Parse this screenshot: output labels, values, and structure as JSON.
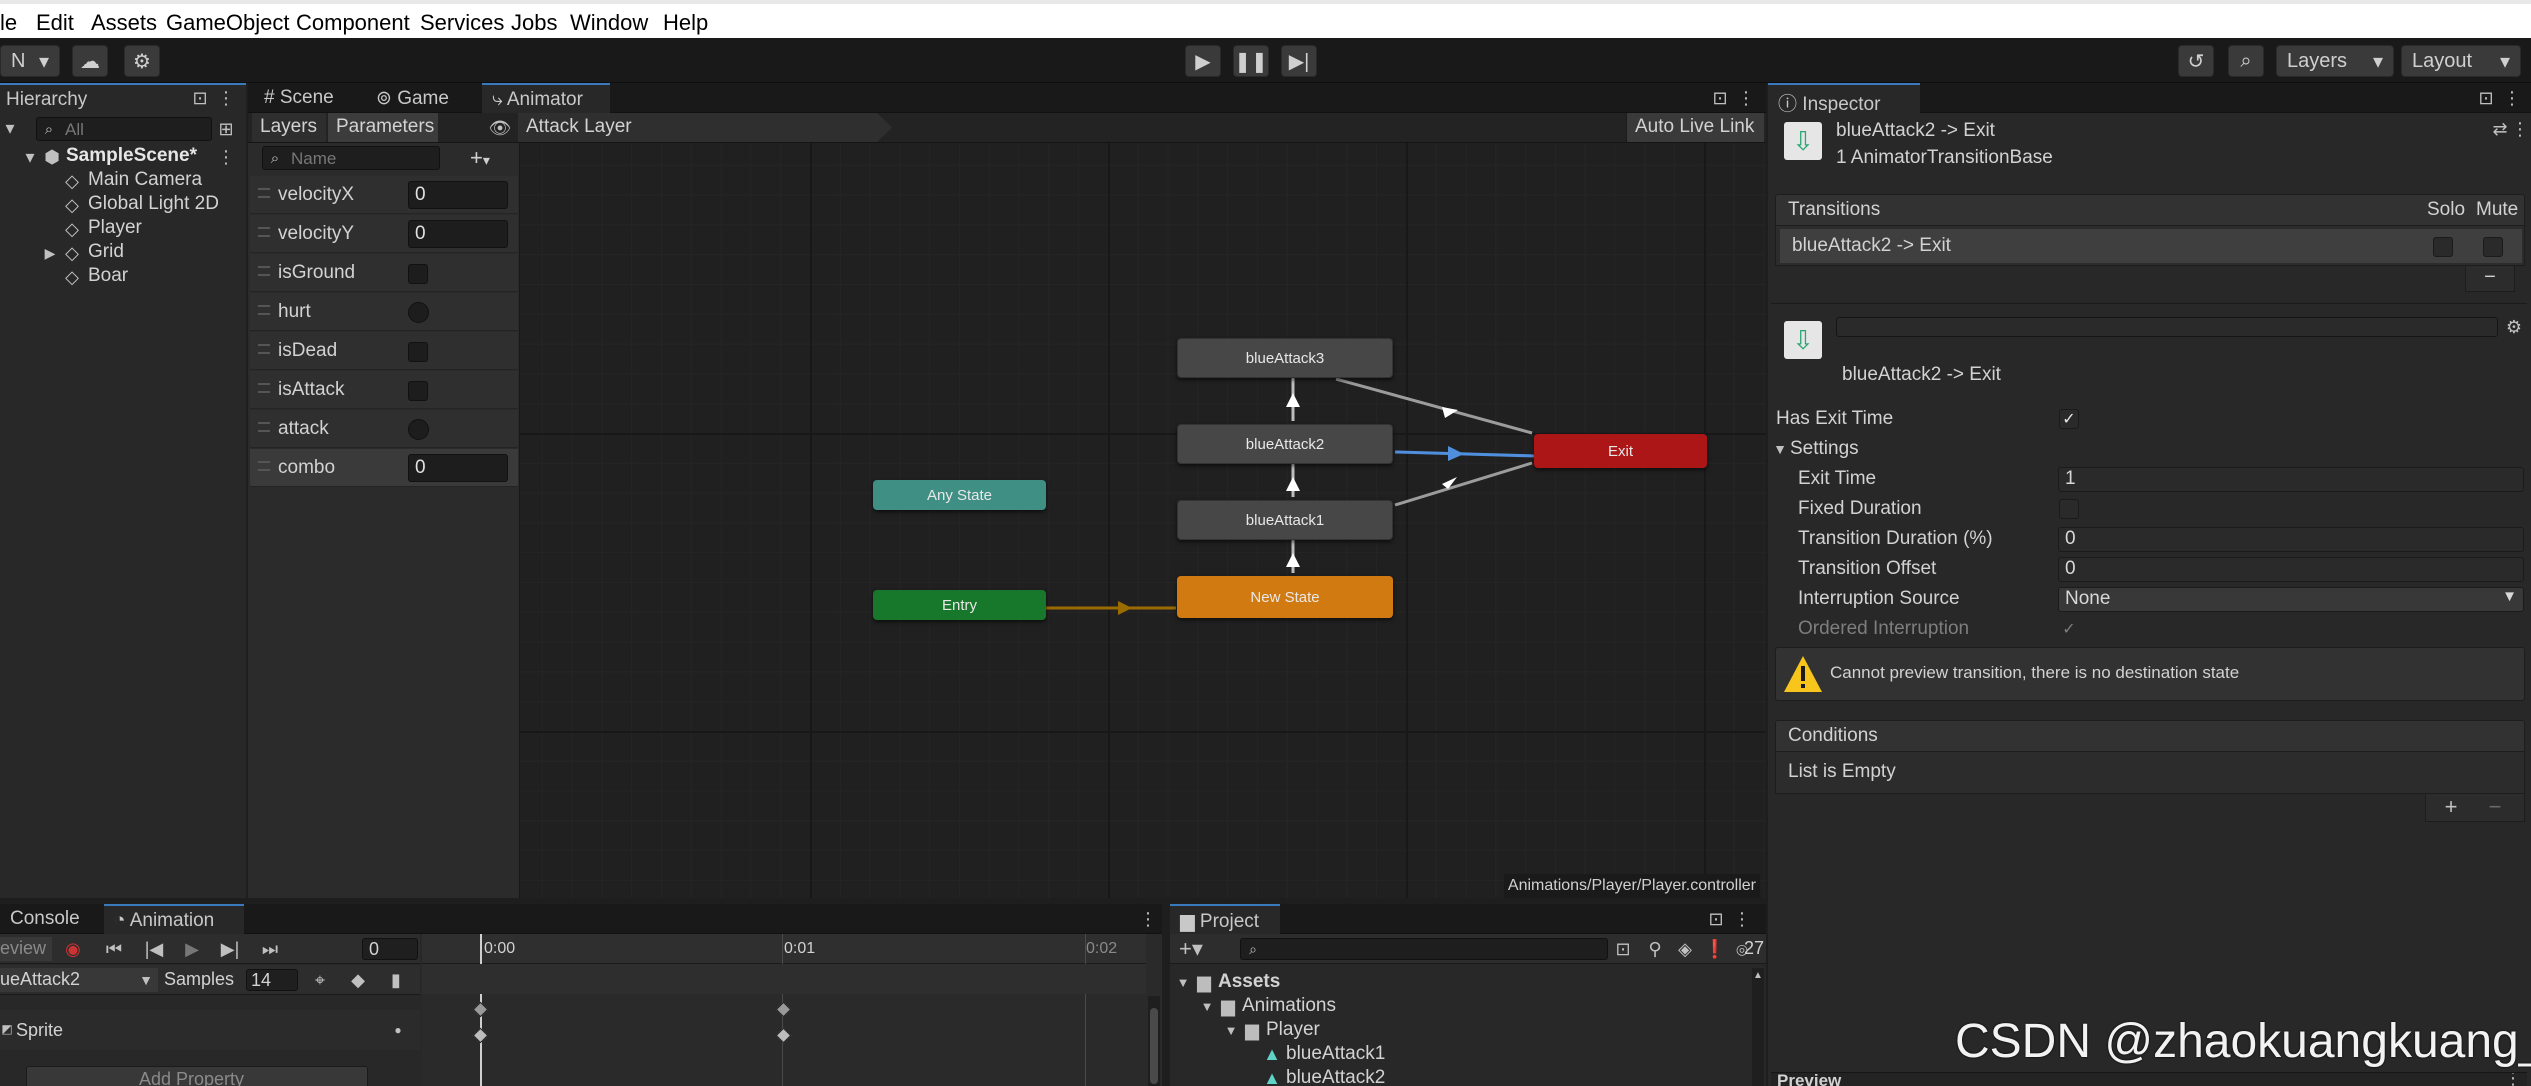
{
  "menu": [
    "le",
    "Edit",
    "Assets",
    "GameObject",
    "Component",
    "Services",
    "Jobs",
    "Window",
    "Help"
  ],
  "toolbar": {
    "account": "N",
    "layers": "Layers",
    "layout": "Layout"
  },
  "hierarchy": {
    "tab": "Hierarchy",
    "search_placeholder": "All",
    "scene": "SampleScene*",
    "items": [
      "Main Camera",
      "Global Light 2D",
      "Player",
      "Grid",
      "Boar"
    ]
  },
  "center_tabs": [
    "Scene",
    "Game",
    "Animator"
  ],
  "animator": {
    "sub_tabs": [
      "Layers",
      "Parameters"
    ],
    "layer_name": "Attack Layer",
    "auto_live_link": "Auto Live Link",
    "search_placeholder": "Name",
    "parameters": [
      {
        "name": "velocityX",
        "type": "float",
        "value": "0"
      },
      {
        "name": "velocityY",
        "type": "float",
        "value": "0"
      },
      {
        "name": "isGround",
        "type": "bool"
      },
      {
        "name": "hurt",
        "type": "trigger"
      },
      {
        "name": "isDead",
        "type": "bool"
      },
      {
        "name": "isAttack",
        "type": "bool"
      },
      {
        "name": "attack",
        "type": "trigger"
      },
      {
        "name": "combo",
        "type": "int",
        "value": "0"
      }
    ],
    "nodes": {
      "any_state": "Any State",
      "entry": "Entry",
      "new_state": "New State",
      "attack1": "blueAttack1",
      "attack2": "blueAttack2",
      "attack3": "blueAttack3",
      "exit": "Exit"
    },
    "path": "Animations/Player/Player.controller",
    "colors": {
      "any_state": "#3f8f84",
      "entry": "#17772a",
      "new_state": "#d27a12",
      "exit": "#ac1616",
      "state": "#474747",
      "selected_transition": "#4f8fdd"
    }
  },
  "inspector": {
    "tab": "Inspector",
    "title": "blueAttack2 -> Exit",
    "subtitle": "1 AnimatorTransitionBase",
    "transitions_header": "Transitions",
    "solo": "Solo",
    "mute": "Mute",
    "transition_item": "blueAttack2 -> Exit",
    "detail_title": "blueAttack2 -> Exit",
    "has_exit_time": "Has Exit Time",
    "settings": "Settings",
    "exit_time": {
      "label": "Exit Time",
      "value": "1"
    },
    "fixed_duration": "Fixed Duration",
    "transition_duration": {
      "label": "Transition Duration (%)",
      "value": "0"
    },
    "transition_offset": {
      "label": "Transition Offset",
      "value": "0"
    },
    "interruption_source": {
      "label": "Interruption Source",
      "value": "None"
    },
    "ordered_interruption": "Ordered Interruption",
    "warning": "Cannot preview transition, there is no destination state",
    "conditions_header": "Conditions",
    "conditions_empty": "List is Empty",
    "preview": "Preview"
  },
  "animation": {
    "tabs": [
      "Console",
      "Animation"
    ],
    "preview": "eview",
    "frame": "0",
    "clip": "ueAttack2",
    "samples_label": "Samples",
    "samples": "14",
    "track": "Sprite",
    "add_property": "Add Property",
    "timeline": [
      "0:00",
      "0:01",
      "0:02"
    ]
  },
  "project": {
    "tab": "Project",
    "count": "27",
    "tree": [
      "Assets",
      "Animations",
      "Player",
      "blueAttack1",
      "blueAttack2"
    ]
  },
  "watermark": "CSDN @zhaokuangkuang_"
}
